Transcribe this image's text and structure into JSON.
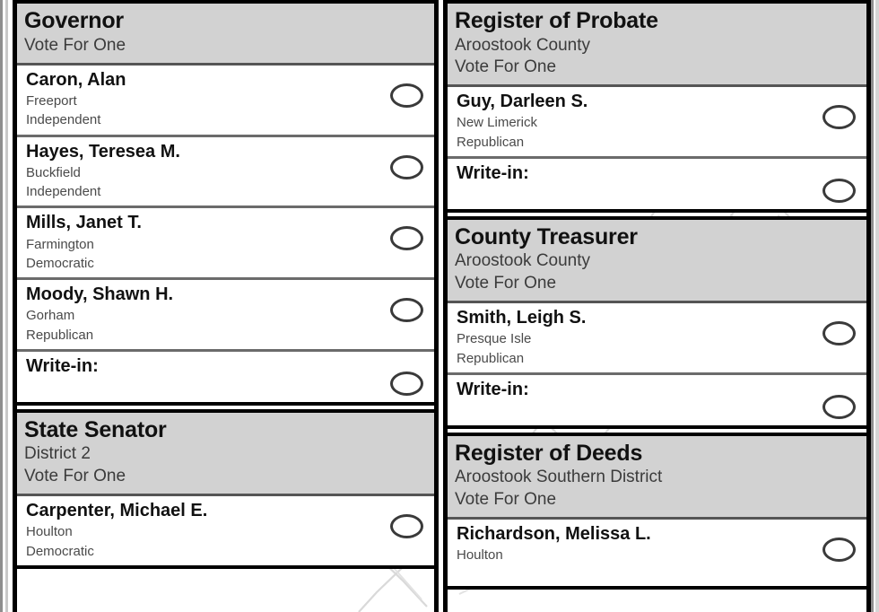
{
  "ballot": {
    "vote_instruction": "Vote For One",
    "writein_label": "Write-in:",
    "oval_icon": "vote-oval-icon",
    "colors": {
      "header_bg": "#d2d2d2",
      "border": "#000000",
      "row_rule": "#6b6b6b",
      "name_text": "#111111",
      "detail_text": "#4a4a4a",
      "oval_stroke": "#3a3a3a",
      "watermark": "#d9d9d9"
    }
  },
  "columns": [
    {
      "id": "left",
      "contests": [
        {
          "title": "Governor",
          "district": "",
          "instruction": "Vote For One",
          "candidates": [
            {
              "name": "Caron, Alan",
              "city": "Freeport",
              "party": "Independent"
            },
            {
              "name": "Hayes, Teresea M.",
              "city": "Buckfield",
              "party": "Independent"
            },
            {
              "name": "Mills, Janet T.",
              "city": "Farmington",
              "party": "Democratic"
            },
            {
              "name": "Moody, Shawn H.",
              "city": "Gorham",
              "party": "Republican"
            }
          ],
          "writein": "Write-in:"
        },
        {
          "title": "State Senator",
          "district": "District 2",
          "instruction": "Vote For One",
          "candidates": [
            {
              "name": "Carpenter, Michael E.",
              "city": "Houlton",
              "party": "Democratic"
            }
          ],
          "writein": null
        }
      ]
    },
    {
      "id": "right",
      "contests": [
        {
          "title": "Register of Probate",
          "district": "Aroostook County",
          "instruction": "Vote For One",
          "candidates": [
            {
              "name": "Guy, Darleen S.",
              "city": "New Limerick",
              "party": "Republican"
            }
          ],
          "writein": "Write-in:"
        },
        {
          "title": "County Treasurer",
          "district": "Aroostook County",
          "instruction": "Vote For One",
          "candidates": [
            {
              "name": "Smith, Leigh S.",
              "city": "Presque Isle",
              "party": "Republican"
            }
          ],
          "writein": "Write-in:"
        },
        {
          "title": "Register of Deeds",
          "district": "Aroostook Southern District",
          "instruction": "Vote For One",
          "candidates": [
            {
              "name": "Richardson, Melissa L.",
              "city": "Houlton",
              "party": ""
            }
          ],
          "writein": null
        }
      ]
    }
  ]
}
